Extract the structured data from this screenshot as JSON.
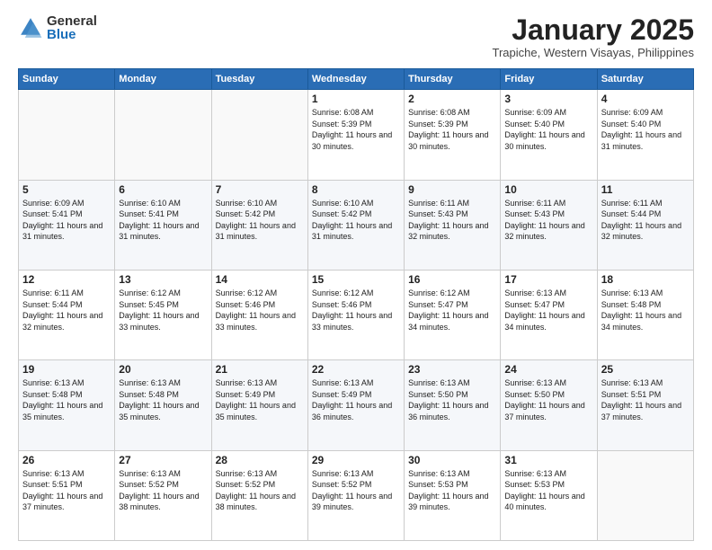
{
  "logo": {
    "general": "General",
    "blue": "Blue"
  },
  "header": {
    "month": "January 2025",
    "location": "Trapiche, Western Visayas, Philippines"
  },
  "days": [
    "Sunday",
    "Monday",
    "Tuesday",
    "Wednesday",
    "Thursday",
    "Friday",
    "Saturday"
  ],
  "weeks": [
    [
      {
        "day": null,
        "sunrise": null,
        "sunset": null,
        "daylight": null
      },
      {
        "day": null,
        "sunrise": null,
        "sunset": null,
        "daylight": null
      },
      {
        "day": null,
        "sunrise": null,
        "sunset": null,
        "daylight": null
      },
      {
        "day": "1",
        "sunrise": "6:08 AM",
        "sunset": "5:39 PM",
        "daylight": "11 hours and 30 minutes."
      },
      {
        "day": "2",
        "sunrise": "6:08 AM",
        "sunset": "5:39 PM",
        "daylight": "11 hours and 30 minutes."
      },
      {
        "day": "3",
        "sunrise": "6:09 AM",
        "sunset": "5:40 PM",
        "daylight": "11 hours and 30 minutes."
      },
      {
        "day": "4",
        "sunrise": "6:09 AM",
        "sunset": "5:40 PM",
        "daylight": "11 hours and 31 minutes."
      }
    ],
    [
      {
        "day": "5",
        "sunrise": "6:09 AM",
        "sunset": "5:41 PM",
        "daylight": "11 hours and 31 minutes."
      },
      {
        "day": "6",
        "sunrise": "6:10 AM",
        "sunset": "5:41 PM",
        "daylight": "11 hours and 31 minutes."
      },
      {
        "day": "7",
        "sunrise": "6:10 AM",
        "sunset": "5:42 PM",
        "daylight": "11 hours and 31 minutes."
      },
      {
        "day": "8",
        "sunrise": "6:10 AM",
        "sunset": "5:42 PM",
        "daylight": "11 hours and 31 minutes."
      },
      {
        "day": "9",
        "sunrise": "6:11 AM",
        "sunset": "5:43 PM",
        "daylight": "11 hours and 32 minutes."
      },
      {
        "day": "10",
        "sunrise": "6:11 AM",
        "sunset": "5:43 PM",
        "daylight": "11 hours and 32 minutes."
      },
      {
        "day": "11",
        "sunrise": "6:11 AM",
        "sunset": "5:44 PM",
        "daylight": "11 hours and 32 minutes."
      }
    ],
    [
      {
        "day": "12",
        "sunrise": "6:11 AM",
        "sunset": "5:44 PM",
        "daylight": "11 hours and 32 minutes."
      },
      {
        "day": "13",
        "sunrise": "6:12 AM",
        "sunset": "5:45 PM",
        "daylight": "11 hours and 33 minutes."
      },
      {
        "day": "14",
        "sunrise": "6:12 AM",
        "sunset": "5:46 PM",
        "daylight": "11 hours and 33 minutes."
      },
      {
        "day": "15",
        "sunrise": "6:12 AM",
        "sunset": "5:46 PM",
        "daylight": "11 hours and 33 minutes."
      },
      {
        "day": "16",
        "sunrise": "6:12 AM",
        "sunset": "5:47 PM",
        "daylight": "11 hours and 34 minutes."
      },
      {
        "day": "17",
        "sunrise": "6:13 AM",
        "sunset": "5:47 PM",
        "daylight": "11 hours and 34 minutes."
      },
      {
        "day": "18",
        "sunrise": "6:13 AM",
        "sunset": "5:48 PM",
        "daylight": "11 hours and 34 minutes."
      }
    ],
    [
      {
        "day": "19",
        "sunrise": "6:13 AM",
        "sunset": "5:48 PM",
        "daylight": "11 hours and 35 minutes."
      },
      {
        "day": "20",
        "sunrise": "6:13 AM",
        "sunset": "5:48 PM",
        "daylight": "11 hours and 35 minutes."
      },
      {
        "day": "21",
        "sunrise": "6:13 AM",
        "sunset": "5:49 PM",
        "daylight": "11 hours and 35 minutes."
      },
      {
        "day": "22",
        "sunrise": "6:13 AM",
        "sunset": "5:49 PM",
        "daylight": "11 hours and 36 minutes."
      },
      {
        "day": "23",
        "sunrise": "6:13 AM",
        "sunset": "5:50 PM",
        "daylight": "11 hours and 36 minutes."
      },
      {
        "day": "24",
        "sunrise": "6:13 AM",
        "sunset": "5:50 PM",
        "daylight": "11 hours and 37 minutes."
      },
      {
        "day": "25",
        "sunrise": "6:13 AM",
        "sunset": "5:51 PM",
        "daylight": "11 hours and 37 minutes."
      }
    ],
    [
      {
        "day": "26",
        "sunrise": "6:13 AM",
        "sunset": "5:51 PM",
        "daylight": "11 hours and 37 minutes."
      },
      {
        "day": "27",
        "sunrise": "6:13 AM",
        "sunset": "5:52 PM",
        "daylight": "11 hours and 38 minutes."
      },
      {
        "day": "28",
        "sunrise": "6:13 AM",
        "sunset": "5:52 PM",
        "daylight": "11 hours and 38 minutes."
      },
      {
        "day": "29",
        "sunrise": "6:13 AM",
        "sunset": "5:52 PM",
        "daylight": "11 hours and 39 minutes."
      },
      {
        "day": "30",
        "sunrise": "6:13 AM",
        "sunset": "5:53 PM",
        "daylight": "11 hours and 39 minutes."
      },
      {
        "day": "31",
        "sunrise": "6:13 AM",
        "sunset": "5:53 PM",
        "daylight": "11 hours and 40 minutes."
      },
      {
        "day": null,
        "sunrise": null,
        "sunset": null,
        "daylight": null
      }
    ]
  ]
}
